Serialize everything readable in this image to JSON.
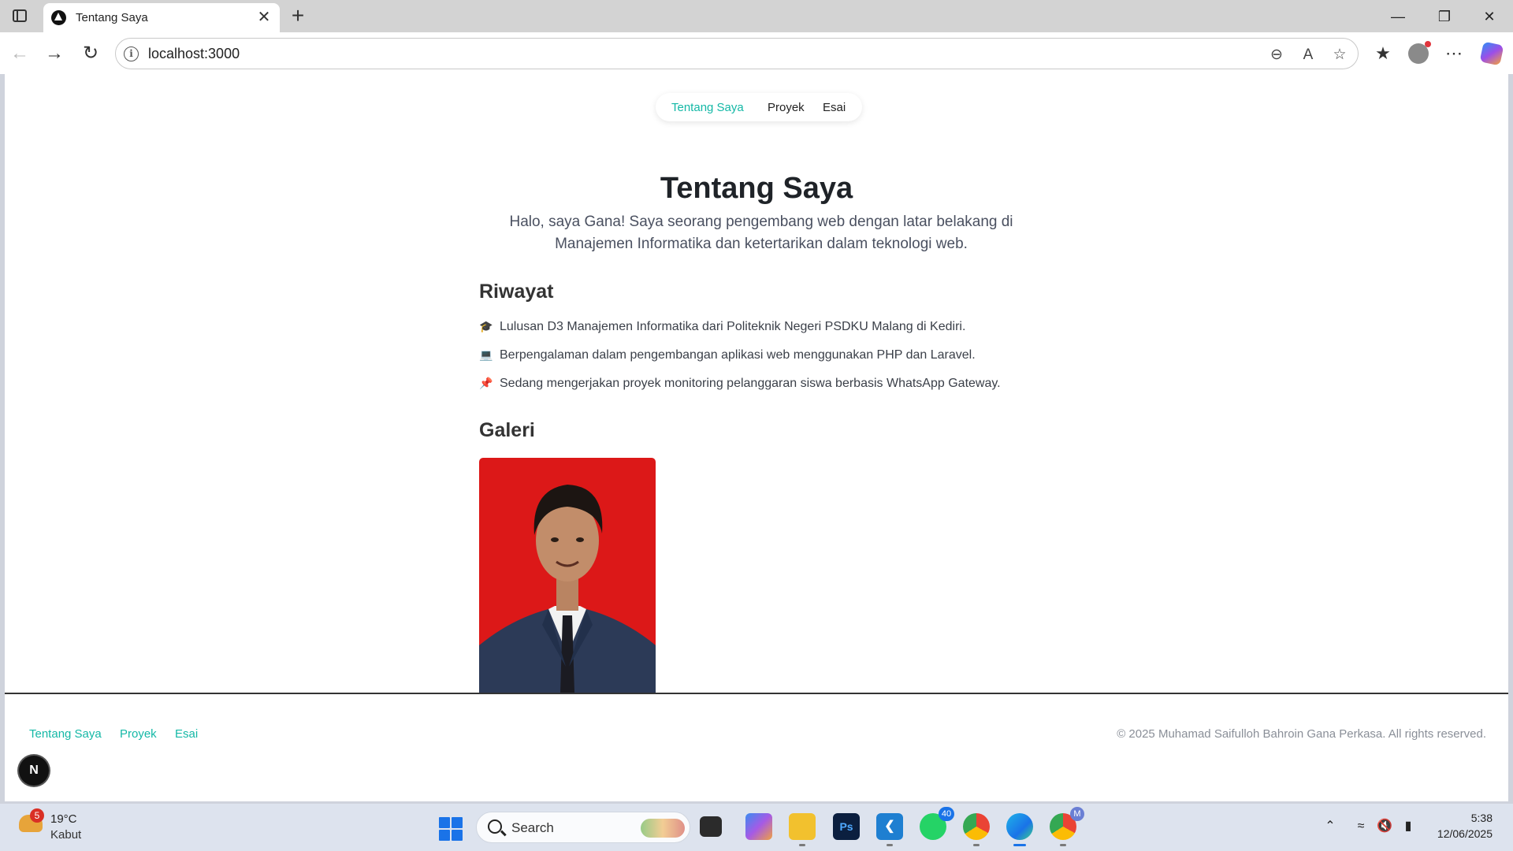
{
  "browser": {
    "tab_title": "Tentang Saya",
    "url": "localhost:3000",
    "new_tab_symbol": "+",
    "close_symbol": "✕"
  },
  "site_nav": {
    "items": [
      "Tentang Saya",
      "Proyek",
      "Esai"
    ],
    "active": "Tentang Saya"
  },
  "hero": {
    "title": "Tentang Saya",
    "description_line1": "Halo, saya Gana! Saya seorang pengembang web dengan latar belakang di",
    "description_line2": "Manajemen Informatika dan ketertarikan dalam teknologi web."
  },
  "riwayat": {
    "title": "Riwayat",
    "items": [
      {
        "emoji": "🎓",
        "text": "Lulusan D3 Manajemen Informatika dari Politeknik Negeri PSDKU Malang di Kediri."
      },
      {
        "emoji": "💻",
        "text": "Berpengalaman dalam pengembangan aplikasi web menggunakan PHP dan Laravel."
      },
      {
        "emoji": "📌",
        "text": "Sedang mengerjakan proyek monitoring pelanggaran siswa berbasis WhatsApp Gateway."
      }
    ]
  },
  "galeri": {
    "title": "Galeri"
  },
  "footer": {
    "links": [
      "Tentang Saya",
      "Proyek",
      "Esai"
    ],
    "copyright": "© 2025 Muhamad Saifulloh Bahroin Gana Perkasa. All rights reserved."
  },
  "dev_badge": "N",
  "taskbar": {
    "weather_temp": "19°C",
    "weather_desc": "Kabut",
    "weather_badge": "5",
    "search_label": "Search",
    "whatsapp_badge": "40",
    "chrome_profile_badge": "M",
    "time": "5:38",
    "date": "12/06/2025"
  },
  "colors": {
    "accent": "#14b8a6",
    "photo_background": "#dc1818"
  }
}
